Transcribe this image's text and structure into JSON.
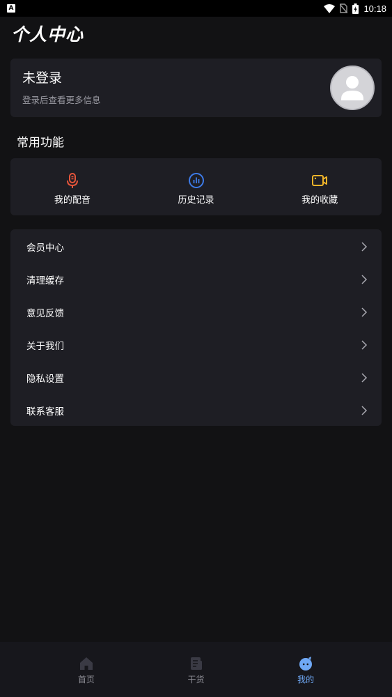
{
  "status_bar": {
    "app_indicator": "A",
    "time": "10:18"
  },
  "header": {
    "title": "个人中心"
  },
  "login": {
    "title": "未登录",
    "subtitle": "登录后查看更多信息"
  },
  "quick": {
    "section_title": "常用功能",
    "items": [
      {
        "label": "我的配音",
        "icon": "microphone-icon",
        "color": "#e5553b"
      },
      {
        "label": "历史记录",
        "icon": "history-chart-icon",
        "color": "#3d7be8"
      },
      {
        "label": "我的收藏",
        "icon": "video-camera-icon",
        "color": "#f0b429"
      }
    ]
  },
  "menu": {
    "items": [
      {
        "label": "会员中心"
      },
      {
        "label": "清理缓存"
      },
      {
        "label": "意见反馈"
      },
      {
        "label": "关于我们"
      },
      {
        "label": "隐私设置"
      },
      {
        "label": "联系客服"
      }
    ]
  },
  "nav": {
    "items": [
      {
        "label": "首页",
        "icon": "home-icon"
      },
      {
        "label": "干货",
        "icon": "document-icon"
      },
      {
        "label": "我的",
        "icon": "profile-face-icon",
        "active": true
      }
    ],
    "active_color": "#6fa8f5"
  }
}
